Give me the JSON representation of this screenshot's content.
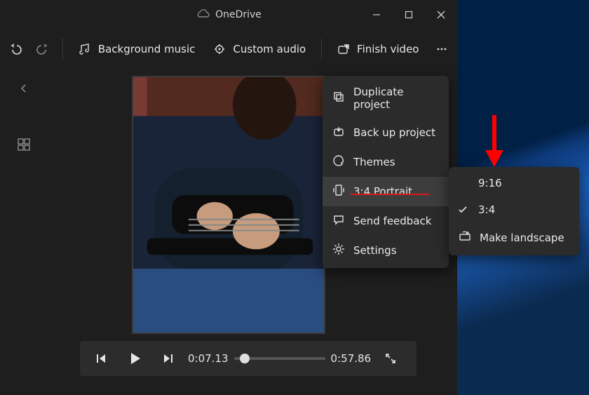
{
  "window": {
    "title": "OneDrive",
    "controls": {
      "min": "minimize",
      "max": "maximize",
      "close": "close"
    }
  },
  "toolbar": {
    "undo": "Undo",
    "redo": "Redo",
    "bg_music": "Background music",
    "custom_audio": "Custom audio",
    "finish": "Finish video",
    "more": "See more"
  },
  "left": {
    "back": "Back",
    "storyboard": "Storyboard"
  },
  "playback": {
    "prev_frame": "Previous frame",
    "play": "Play",
    "next_frame": "Next frame",
    "current": "0:07.13",
    "total": "0:57.86",
    "fullscreen": "Full screen"
  },
  "menu": {
    "items": [
      {
        "icon": "duplicate-icon",
        "label": "Duplicate project"
      },
      {
        "icon": "backup-icon",
        "label": "Back up project"
      },
      {
        "icon": "themes-icon",
        "label": "Themes"
      },
      {
        "icon": "aspect-icon",
        "label": "3:4 Portrait",
        "highlight": true
      },
      {
        "icon": "feedback-icon",
        "label": "Send feedback"
      },
      {
        "icon": "settings-icon",
        "label": "Settings"
      }
    ]
  },
  "submenu": {
    "opt_916": "9:16",
    "opt_34": "3:4",
    "landscape": "Make landscape"
  },
  "colors": {
    "accent_underline": "#d81b1b",
    "arrow": "#ff0000"
  }
}
